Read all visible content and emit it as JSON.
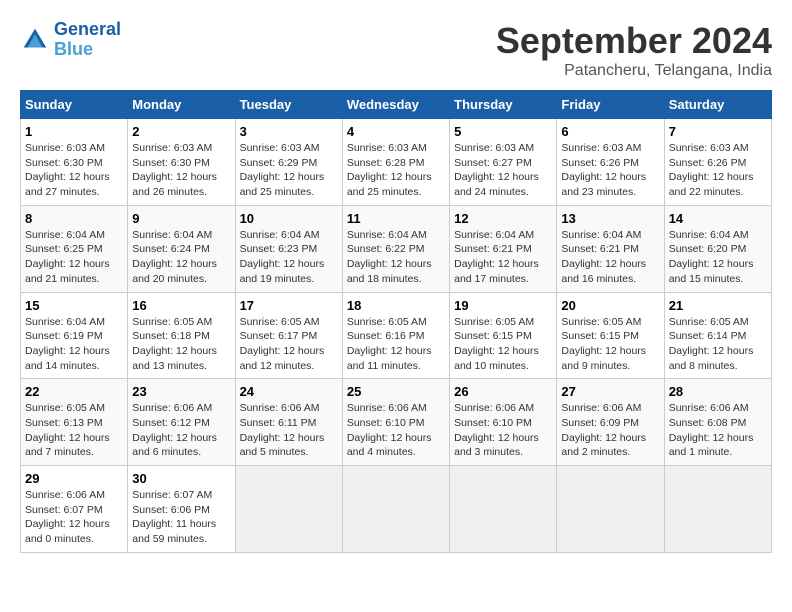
{
  "logo": {
    "line1": "General",
    "line2": "Blue"
  },
  "title": "September 2024",
  "subtitle": "Patancheru, Telangana, India",
  "days_of_week": [
    "Sunday",
    "Monday",
    "Tuesday",
    "Wednesday",
    "Thursday",
    "Friday",
    "Saturday"
  ],
  "weeks": [
    [
      {
        "day": "1",
        "sunrise": "6:03 AM",
        "sunset": "6:30 PM",
        "daylight": "12 hours and 27 minutes."
      },
      {
        "day": "2",
        "sunrise": "6:03 AM",
        "sunset": "6:30 PM",
        "daylight": "12 hours and 26 minutes."
      },
      {
        "day": "3",
        "sunrise": "6:03 AM",
        "sunset": "6:29 PM",
        "daylight": "12 hours and 25 minutes."
      },
      {
        "day": "4",
        "sunrise": "6:03 AM",
        "sunset": "6:28 PM",
        "daylight": "12 hours and 25 minutes."
      },
      {
        "day": "5",
        "sunrise": "6:03 AM",
        "sunset": "6:27 PM",
        "daylight": "12 hours and 24 minutes."
      },
      {
        "day": "6",
        "sunrise": "6:03 AM",
        "sunset": "6:26 PM",
        "daylight": "12 hours and 23 minutes."
      },
      {
        "day": "7",
        "sunrise": "6:03 AM",
        "sunset": "6:26 PM",
        "daylight": "12 hours and 22 minutes."
      }
    ],
    [
      {
        "day": "8",
        "sunrise": "6:04 AM",
        "sunset": "6:25 PM",
        "daylight": "12 hours and 21 minutes."
      },
      {
        "day": "9",
        "sunrise": "6:04 AM",
        "sunset": "6:24 PM",
        "daylight": "12 hours and 20 minutes."
      },
      {
        "day": "10",
        "sunrise": "6:04 AM",
        "sunset": "6:23 PM",
        "daylight": "12 hours and 19 minutes."
      },
      {
        "day": "11",
        "sunrise": "6:04 AM",
        "sunset": "6:22 PM",
        "daylight": "12 hours and 18 minutes."
      },
      {
        "day": "12",
        "sunrise": "6:04 AM",
        "sunset": "6:21 PM",
        "daylight": "12 hours and 17 minutes."
      },
      {
        "day": "13",
        "sunrise": "6:04 AM",
        "sunset": "6:21 PM",
        "daylight": "12 hours and 16 minutes."
      },
      {
        "day": "14",
        "sunrise": "6:04 AM",
        "sunset": "6:20 PM",
        "daylight": "12 hours and 15 minutes."
      }
    ],
    [
      {
        "day": "15",
        "sunrise": "6:04 AM",
        "sunset": "6:19 PM",
        "daylight": "12 hours and 14 minutes."
      },
      {
        "day": "16",
        "sunrise": "6:05 AM",
        "sunset": "6:18 PM",
        "daylight": "12 hours and 13 minutes."
      },
      {
        "day": "17",
        "sunrise": "6:05 AM",
        "sunset": "6:17 PM",
        "daylight": "12 hours and 12 minutes."
      },
      {
        "day": "18",
        "sunrise": "6:05 AM",
        "sunset": "6:16 PM",
        "daylight": "12 hours and 11 minutes."
      },
      {
        "day": "19",
        "sunrise": "6:05 AM",
        "sunset": "6:15 PM",
        "daylight": "12 hours and 10 minutes."
      },
      {
        "day": "20",
        "sunrise": "6:05 AM",
        "sunset": "6:15 PM",
        "daylight": "12 hours and 9 minutes."
      },
      {
        "day": "21",
        "sunrise": "6:05 AM",
        "sunset": "6:14 PM",
        "daylight": "12 hours and 8 minutes."
      }
    ],
    [
      {
        "day": "22",
        "sunrise": "6:05 AM",
        "sunset": "6:13 PM",
        "daylight": "12 hours and 7 minutes."
      },
      {
        "day": "23",
        "sunrise": "6:06 AM",
        "sunset": "6:12 PM",
        "daylight": "12 hours and 6 minutes."
      },
      {
        "day": "24",
        "sunrise": "6:06 AM",
        "sunset": "6:11 PM",
        "daylight": "12 hours and 5 minutes."
      },
      {
        "day": "25",
        "sunrise": "6:06 AM",
        "sunset": "6:10 PM",
        "daylight": "12 hours and 4 minutes."
      },
      {
        "day": "26",
        "sunrise": "6:06 AM",
        "sunset": "6:10 PM",
        "daylight": "12 hours and 3 minutes."
      },
      {
        "day": "27",
        "sunrise": "6:06 AM",
        "sunset": "6:09 PM",
        "daylight": "12 hours and 2 minutes."
      },
      {
        "day": "28",
        "sunrise": "6:06 AM",
        "sunset": "6:08 PM",
        "daylight": "12 hours and 1 minute."
      }
    ],
    [
      {
        "day": "29",
        "sunrise": "6:06 AM",
        "sunset": "6:07 PM",
        "daylight": "12 hours and 0 minutes."
      },
      {
        "day": "30",
        "sunrise": "6:07 AM",
        "sunset": "6:06 PM",
        "daylight": "11 hours and 59 minutes."
      },
      null,
      null,
      null,
      null,
      null
    ]
  ],
  "labels": {
    "sunrise": "Sunrise:",
    "sunset": "Sunset:",
    "daylight": "Daylight:"
  }
}
